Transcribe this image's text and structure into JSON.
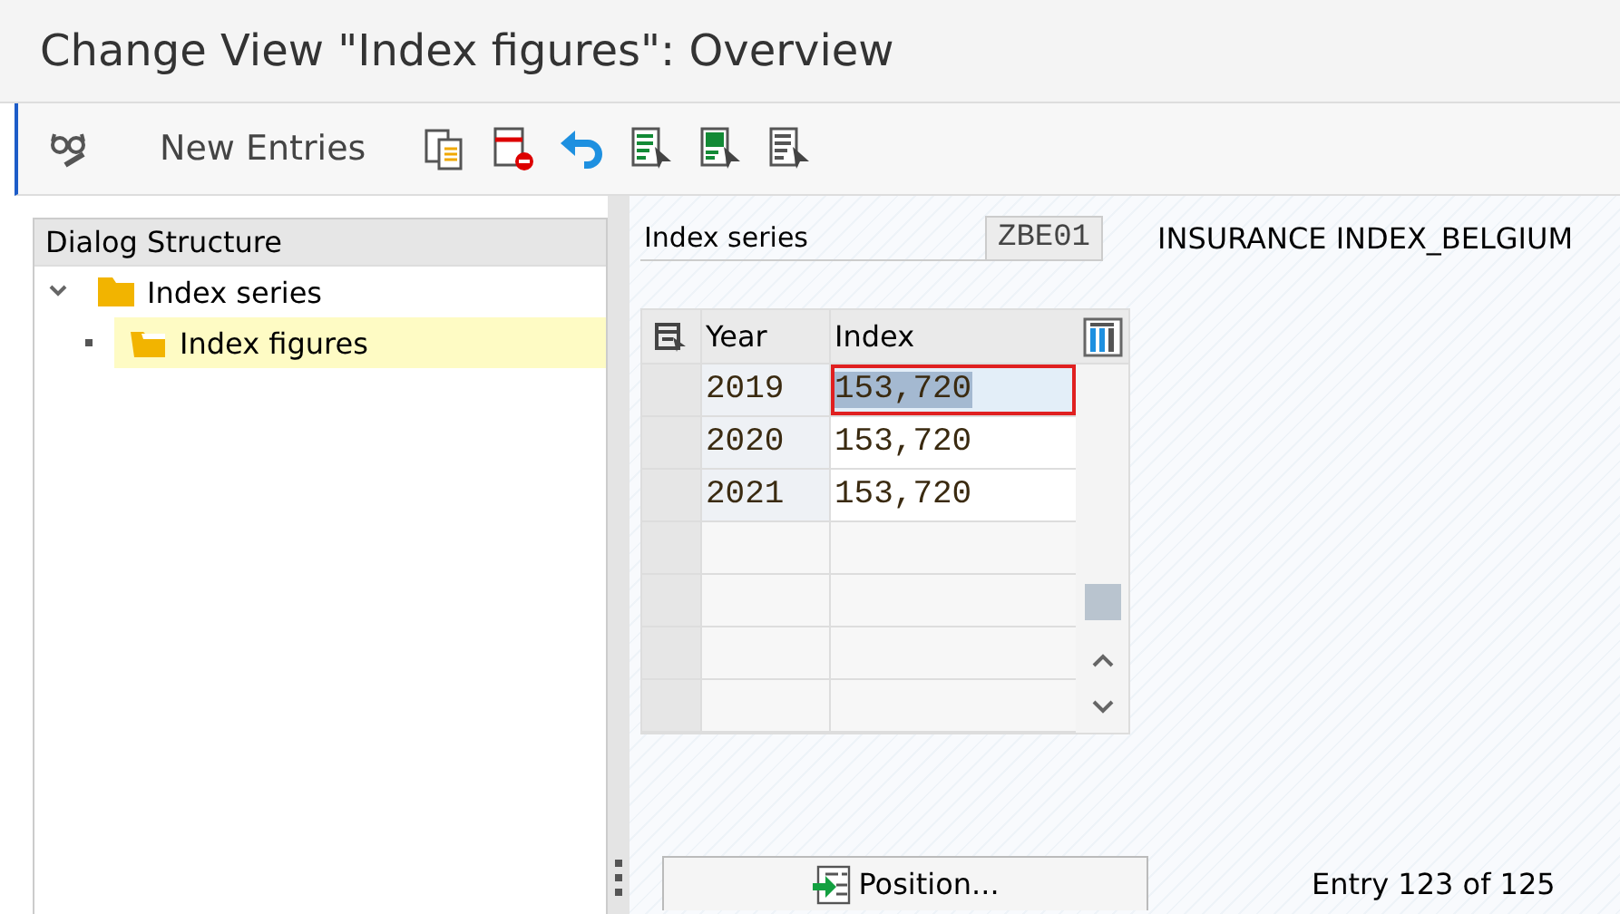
{
  "window": {
    "title": "Change View \"Index figures\": Overview"
  },
  "toolbar": [
    {
      "kind": "display-change"
    },
    {
      "kind": "text",
      "label": "New Entries"
    },
    {
      "kind": "copy"
    },
    {
      "kind": "delete"
    },
    {
      "kind": "undo"
    },
    {
      "kind": "select-all"
    },
    {
      "kind": "select-block"
    },
    {
      "kind": "deselect-all"
    }
  ],
  "sidebar": {
    "title": "Dialog Structure",
    "items": [
      {
        "label": "Index series",
        "expanded": true,
        "selected": false,
        "children": [
          {
            "label": "Index figures",
            "expanded": false,
            "selected": true
          }
        ]
      }
    ]
  },
  "series": {
    "label": "Index series",
    "value": "ZBE01",
    "description": "INSURANCE INDEX_BELGIUM"
  },
  "table": {
    "columns": [
      "Year",
      "Index"
    ],
    "rows": [
      {
        "year": "2019",
        "index": "153,720",
        "selected": true
      },
      {
        "year": "2020",
        "index": "153,720",
        "selected": false
      },
      {
        "year": "2021",
        "index": "153,720",
        "selected": false
      }
    ]
  },
  "position_button": "Position...",
  "status": "Entry 123 of 125"
}
